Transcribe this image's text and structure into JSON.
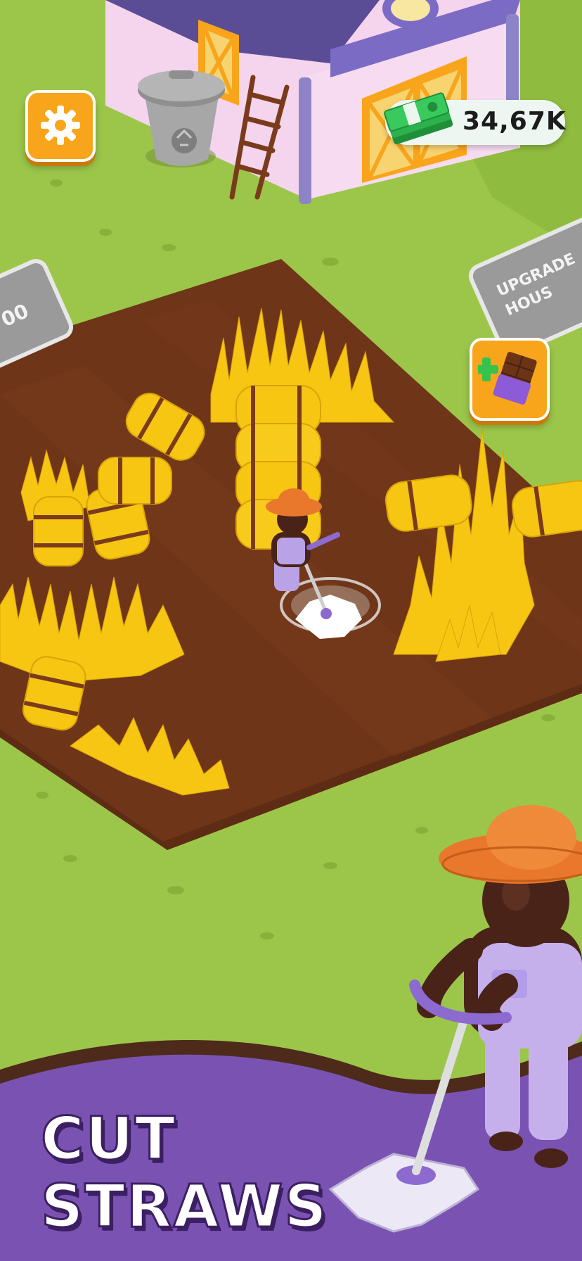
{
  "hud": {
    "settings_icon": "gear-icon",
    "cash_icon": "cash-stack-icon",
    "cash_amount": "34,67K",
    "booster_icon": "plus-chocolate-icon"
  },
  "world": {
    "upgrade_sign_text": "UPGRADE\nHOUS",
    "left_sign_text": "00",
    "trash_icon": "recycle-bin-icon"
  },
  "banner": {
    "line1": "CUT",
    "line2": "STRAWS"
  },
  "colors": {
    "grass": "#9cc64a",
    "soil": "#6b3417",
    "straw": "#f6c613",
    "banner_purple": "#7a53b2",
    "button_orange": "#f9a51c"
  }
}
